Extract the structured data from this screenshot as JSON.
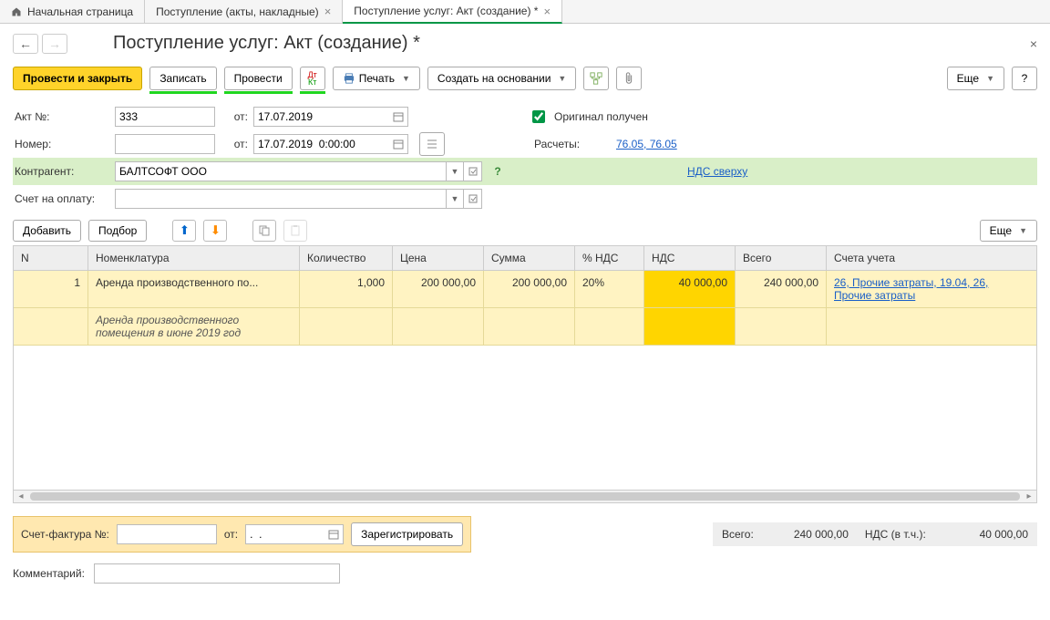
{
  "tabs": [
    {
      "label": "Начальная страница",
      "closable": false
    },
    {
      "label": "Поступление (акты, накладные)",
      "closable": true
    },
    {
      "label": "Поступление услуг: Акт (создание) *",
      "closable": true,
      "active": true
    }
  ],
  "title": "Поступление услуг: Акт (создание) *",
  "toolbar": {
    "post_close": "Провести и закрыть",
    "save": "Записать",
    "post": "Провести",
    "print": "Печать",
    "create_based": "Создать на основании",
    "more": "Еще",
    "help": "?"
  },
  "form": {
    "akt_no_label": "Акт №:",
    "akt_no": "333",
    "ot_label": "от:",
    "akt_date": "17.07.2019",
    "number_label": "Номер:",
    "number": "",
    "number_date": "17.07.2019  0:00:00",
    "original_label": "Оригинал получен",
    "original_checked": true,
    "counterparty_label": "Контрагент:",
    "counterparty": "БАЛТСОФТ ООО",
    "calc_label": "Расчеты:",
    "calc_link": "76.05, 76.05",
    "vat_link": "НДС сверху",
    "invoice_account_label": "Счет на оплату:",
    "invoice_account": ""
  },
  "table_toolbar": {
    "add": "Добавить",
    "pick": "Подбор",
    "more": "Еще"
  },
  "grid": {
    "headers": {
      "n": "N",
      "nom": "Номенклатура",
      "qty": "Количество",
      "price": "Цена",
      "sum": "Сумма",
      "vatp": "% НДС",
      "vat": "НДС",
      "total": "Всего",
      "acc": "Счета учета"
    },
    "rows": [
      {
        "n": "1",
        "nom": "Аренда производственного по...",
        "desc": "Аренда производственного помещения в июне 2019 год",
        "qty": "1,000",
        "price": "200 000,00",
        "sum": "200 000,00",
        "vatp": "20%",
        "vat": "40 000,00",
        "total": "240 000,00",
        "acc": "26, Прочие затраты, 19.04, 26, Прочие затраты"
      }
    ]
  },
  "invoice": {
    "label": "Счет-фактура №:",
    "no": "",
    "ot": "от:",
    "date": ".  .",
    "register": "Зарегистрировать"
  },
  "totals": {
    "total_label": "Всего:",
    "total": "240 000,00",
    "vat_label": "НДС (в т.ч.):",
    "vat": "40 000,00"
  },
  "comment_label": "Комментарий:",
  "comment": ""
}
